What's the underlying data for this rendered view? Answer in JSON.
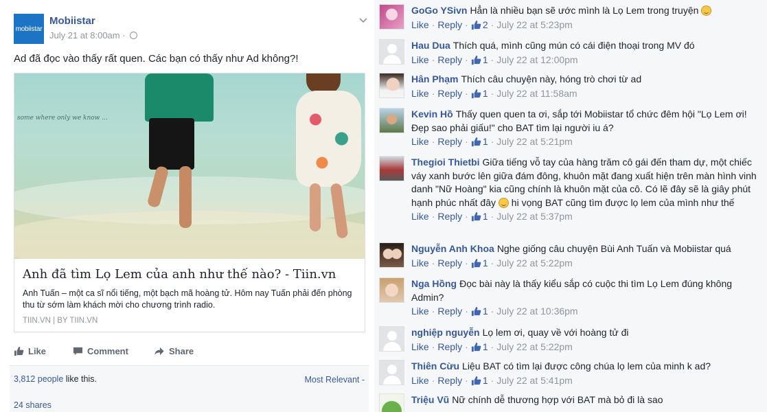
{
  "post": {
    "page_name": "Mobiistar",
    "logo_text": "mobiistar",
    "timestamp": "July 21 at 8:00am · ",
    "text": "Ad đã đọc vào thấy rất quen. Các bạn có thấy như Ad không?!",
    "link": {
      "photo_caption": "some where only we know ...",
      "title": "Anh đã tìm Lọ Lem của anh như thế nào? - Tiin.vn",
      "description": "Anh Tuấn – một ca sĩ nổi tiếng, một bạch mã hoàng tử. Hôm nay Tuấn phải đến phòng thu từ sớm làm khách mời cho chương trình radio.",
      "source": "TIIN.VN | BY TIIN.VN"
    },
    "actions": {
      "like": "Like",
      "comment": "Comment",
      "share": "Share"
    },
    "likes_count": "3,812 people",
    "likes_suffix": " like this.",
    "sort_label": "Most Relevant -",
    "shares": "24 shares"
  },
  "comment_meta": {
    "like": "Like",
    "reply": "Reply"
  },
  "comments": [
    {
      "author": "GoGo YSivn",
      "text": "Hẳn là nhiều bạn sẽ ước mình là Lọ Lem trong truyện",
      "likes": "2",
      "time": "July 22 at 5:23pm",
      "avatar": "pink",
      "emoji": true
    },
    {
      "author": "Hau Dua",
      "text": "Thích quá, mình cũng mún có cái điện thoại trong MV đó",
      "likes": "1",
      "time": "July 22 at 12:00pm",
      "avatar": "gray"
    },
    {
      "author": "Hân Phạm",
      "text": "Thích câu chuyện này, hóng trò chơi từ ad",
      "likes": "1",
      "time": "July 22 at 11:58am",
      "avatar": "girl"
    },
    {
      "author": "Kevin Hồ",
      "text": "Thấy quen quen ta ơi, sắp tới Mobiistar tổ chức đêm hội \"Lọ Lem ơi! Đẹp sao phải giấu!\" cho BAT tìm lại người iu á?",
      "likes": "1",
      "time": "July 22 at 5:21pm",
      "avatar": "outdoor"
    },
    {
      "author": "Thegioi Thietbi",
      "text": "Giữa tiếng vỗ tay của hàng trăm cô gái đến tham dự, một chiếc váy xanh bước lên giữa đám đông, khuôn mặt đang xuất hiện trên màn hình vinh danh \"Nữ Hoàng\" kia cũng chính là khuôn mặt của cô. Có lẽ đây sẽ là giây phút hạnh phúc nhất đây",
      "text2": " hi vọng BAT cũng tìm được lọ lem của mình như thế",
      "likes": "1",
      "time": "July 22 at 5:37pm",
      "avatar": "car",
      "emoji": true
    },
    {
      "author": "Nguyễn Anh Khoa",
      "text": "Nghe giống câu chuyện Bùi Anh Tuấn và Mobiistar quá",
      "likes": "1",
      "time": "July 22 at 5:22pm",
      "avatar": "couple"
    },
    {
      "author": "Nga Hồng",
      "text": "Đọc bài này là thấy kiểu sắp có cuộc thi tìm Lọ Lem đúng không Admin?",
      "likes": "1",
      "time": "July 22 at 10:36pm",
      "avatar": "blonde"
    },
    {
      "author": "nghiệp nguyễn",
      "text": "Lọ lem ơi, quay về với hoàng tử đi",
      "likes": "1",
      "time": "July 22 at 5:22pm",
      "avatar": "gray"
    },
    {
      "author": "Thiên Cừu",
      "text": "Liệu BAT có tìm lại được công chúa lọ lem của minh k ad?",
      "likes": "1",
      "time": "July 22 at 5:41pm",
      "avatar": "gray"
    },
    {
      "author": "Triệu Vũ",
      "text": "Nữ chính dễ thương hợp với BAT mà bỏ đi là sao",
      "avatar": "green"
    }
  ]
}
